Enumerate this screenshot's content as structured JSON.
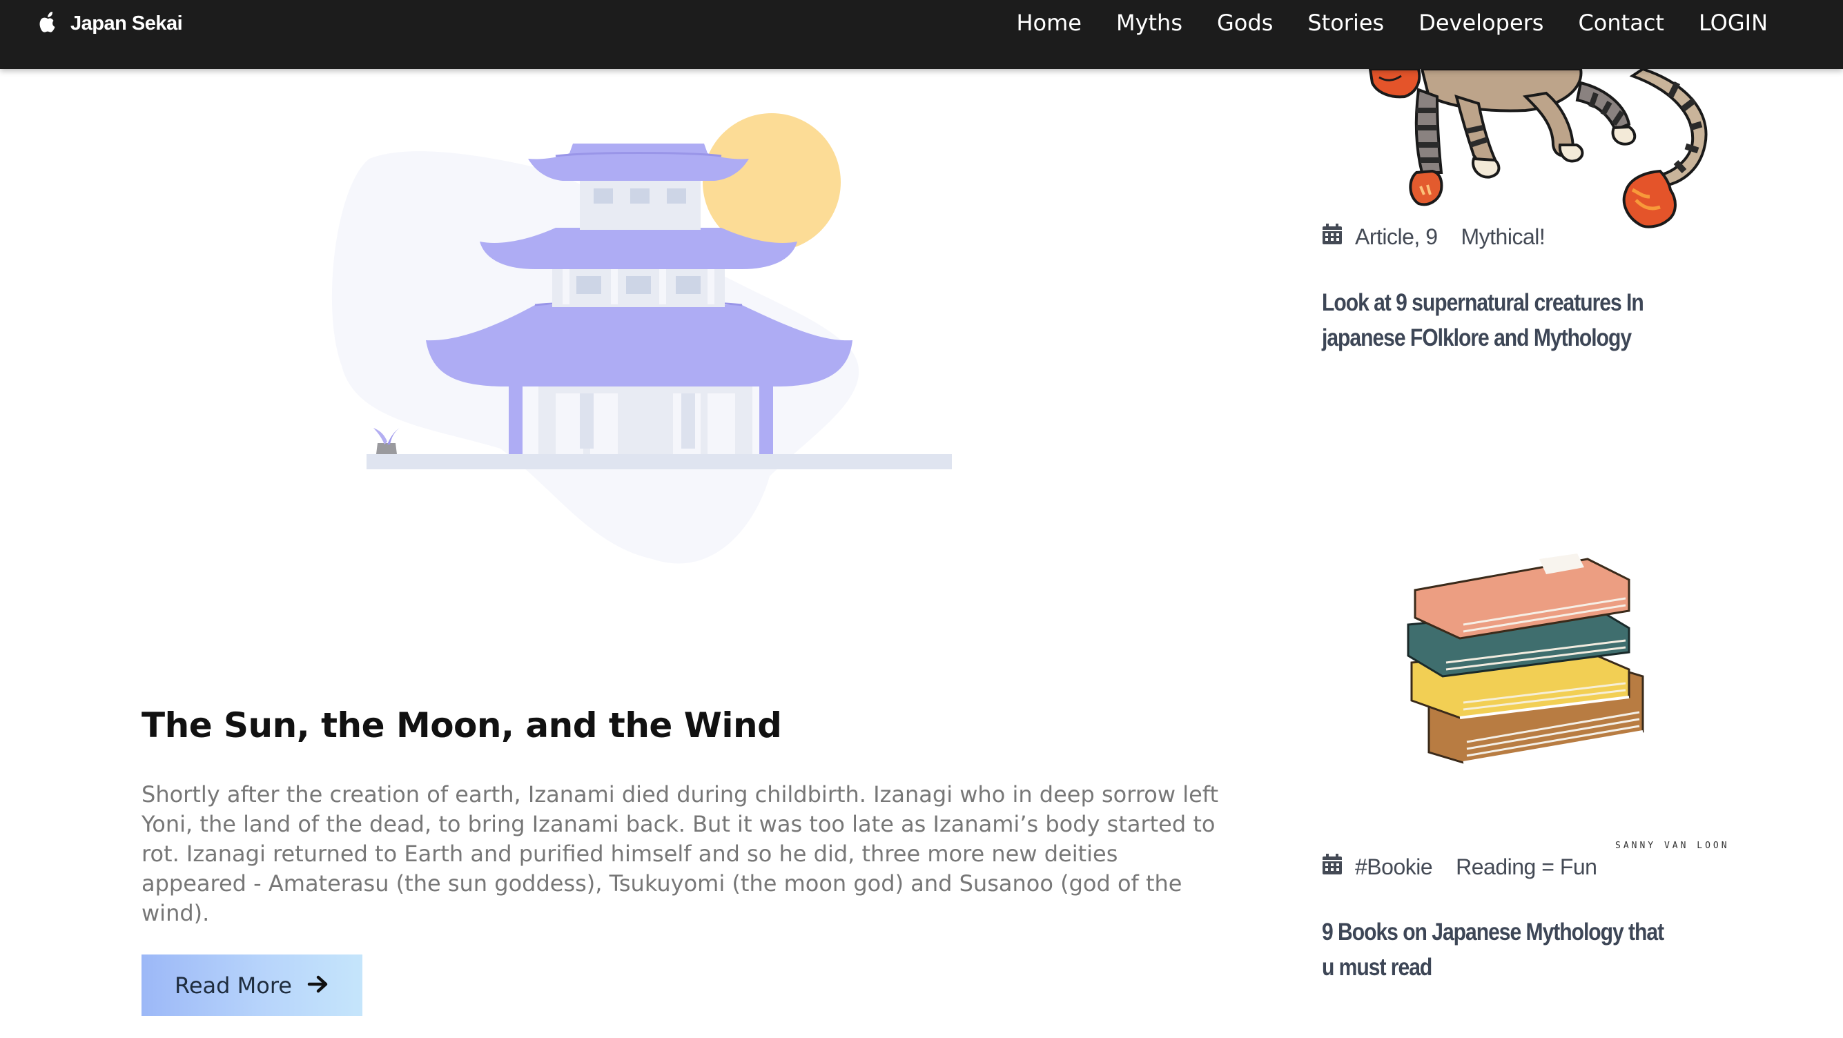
{
  "navbar": {
    "brand": "Japan Sekai",
    "brand_icon": "apple-logo-icon",
    "links": [
      "Home",
      "Myths",
      "Gods",
      "Stories",
      "Developers",
      "Contact",
      "LOGIN"
    ]
  },
  "main_post": {
    "title": "The Sun, the Moon, and the Wind",
    "body": "Shortly after the creation of earth, Izanami died during childbirth. Izanagi who in deep sorrow left Yoni, the land of the dead, to bring Izanami back. But it was too late as Izanami’s body started to rot. Izanagi returned to Earth and purified himself and so he did, three more new deities appeared - Amaterasu (the sun goddess), Tsukuyomi (the moon god) and Susanoo (god of the wind).",
    "button_label": "Read More",
    "button_icon": "arrow-right-icon"
  },
  "sidebar": {
    "posts": [
      {
        "category": "Article, 9",
        "tag": "Mythical!",
        "title": "Look at 9 supernatural creatures In japanese FOlklore and Mythology",
        "meta_icon": "calendar-icon"
      },
      {
        "category": "#Bookie",
        "tag": "Reading = Fun",
        "title": "9 Books on Japanese Mythology that u must read",
        "meta_icon": "calendar-icon",
        "image_signature": "SANNY VAN LOON"
      }
    ]
  },
  "colors": {
    "navbar_bg": "#1c1c1c",
    "pagoda_roof": "#aeacf4",
    "sun": "#fcdc96",
    "button_gradient_start": "#9cb8f7",
    "button_gradient_end": "#c5e5fb",
    "sidebar_title": "#3d4656"
  }
}
